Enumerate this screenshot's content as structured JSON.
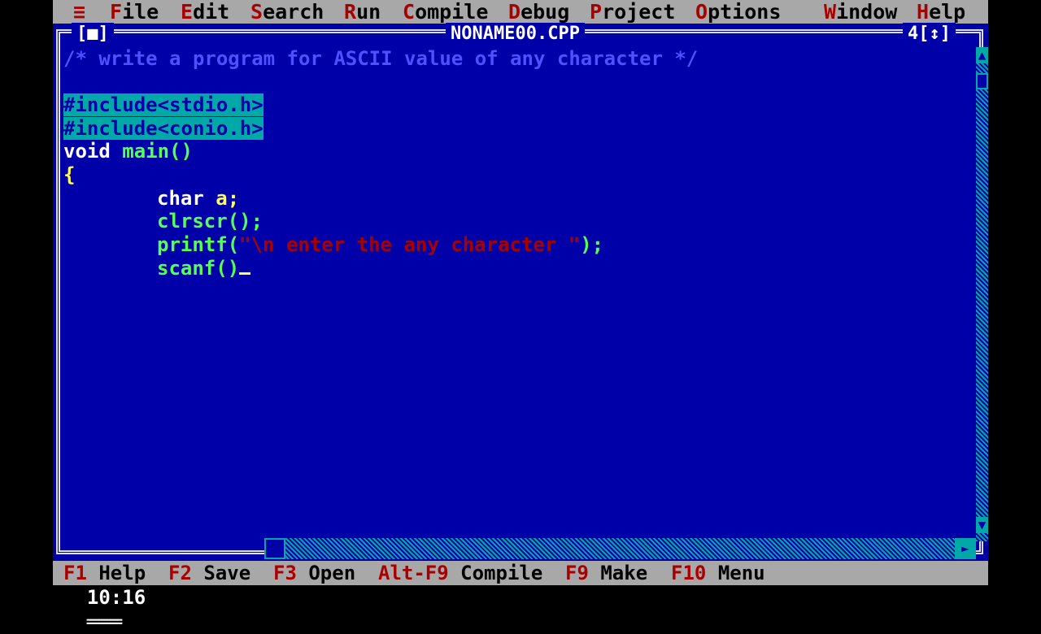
{
  "menu": {
    "system_glyph": "≡",
    "items": [
      {
        "hot": "F",
        "rest": "ile"
      },
      {
        "hot": "E",
        "rest": "dit"
      },
      {
        "hot": "S",
        "rest": "earch"
      },
      {
        "hot": "R",
        "rest": "un"
      },
      {
        "hot": "C",
        "rest": "ompile"
      },
      {
        "hot": "D",
        "rest": "ebug"
      },
      {
        "hot": "P",
        "rest": "roject"
      },
      {
        "hot": "O",
        "rest": "ptions"
      },
      {
        "hot": "W",
        "rest": "indow"
      },
      {
        "hot": "H",
        "rest": "elp"
      }
    ]
  },
  "window": {
    "close_box": "[■]",
    "title": "NONAME00.CPP",
    "number": "4",
    "zoom_box": "[↕]"
  },
  "code": {
    "comment": "/* write a program for ASCII value of any character */",
    "include1": "#include<stdio.h>",
    "include2": "#include<conio.h>",
    "main_kw": "void",
    "main_id": "main()",
    "open_brace": "{",
    "decl_kw": "char",
    "decl_id": "a;",
    "clrscr": "clrscr();",
    "printf_fn": "printf(",
    "printf_str": "\"\\n enter the any character \"",
    "printf_end": ");",
    "scanf_line": "scanf()"
  },
  "status": {
    "position": "10:16"
  },
  "function_keys": [
    {
      "key": "F1",
      "label": "Help"
    },
    {
      "key": "F2",
      "label": "Save"
    },
    {
      "key": "F3",
      "label": "Open"
    },
    {
      "key": "Alt-F9",
      "label": "Compile"
    },
    {
      "key": "F9",
      "label": "Make"
    },
    {
      "key": "F10",
      "label": "Menu"
    }
  ],
  "colors": {
    "editor_bg": "#0000a8",
    "menu_bg": "#a8a8a8",
    "hotkey": "#a80000",
    "selection": "#00a8a8"
  }
}
